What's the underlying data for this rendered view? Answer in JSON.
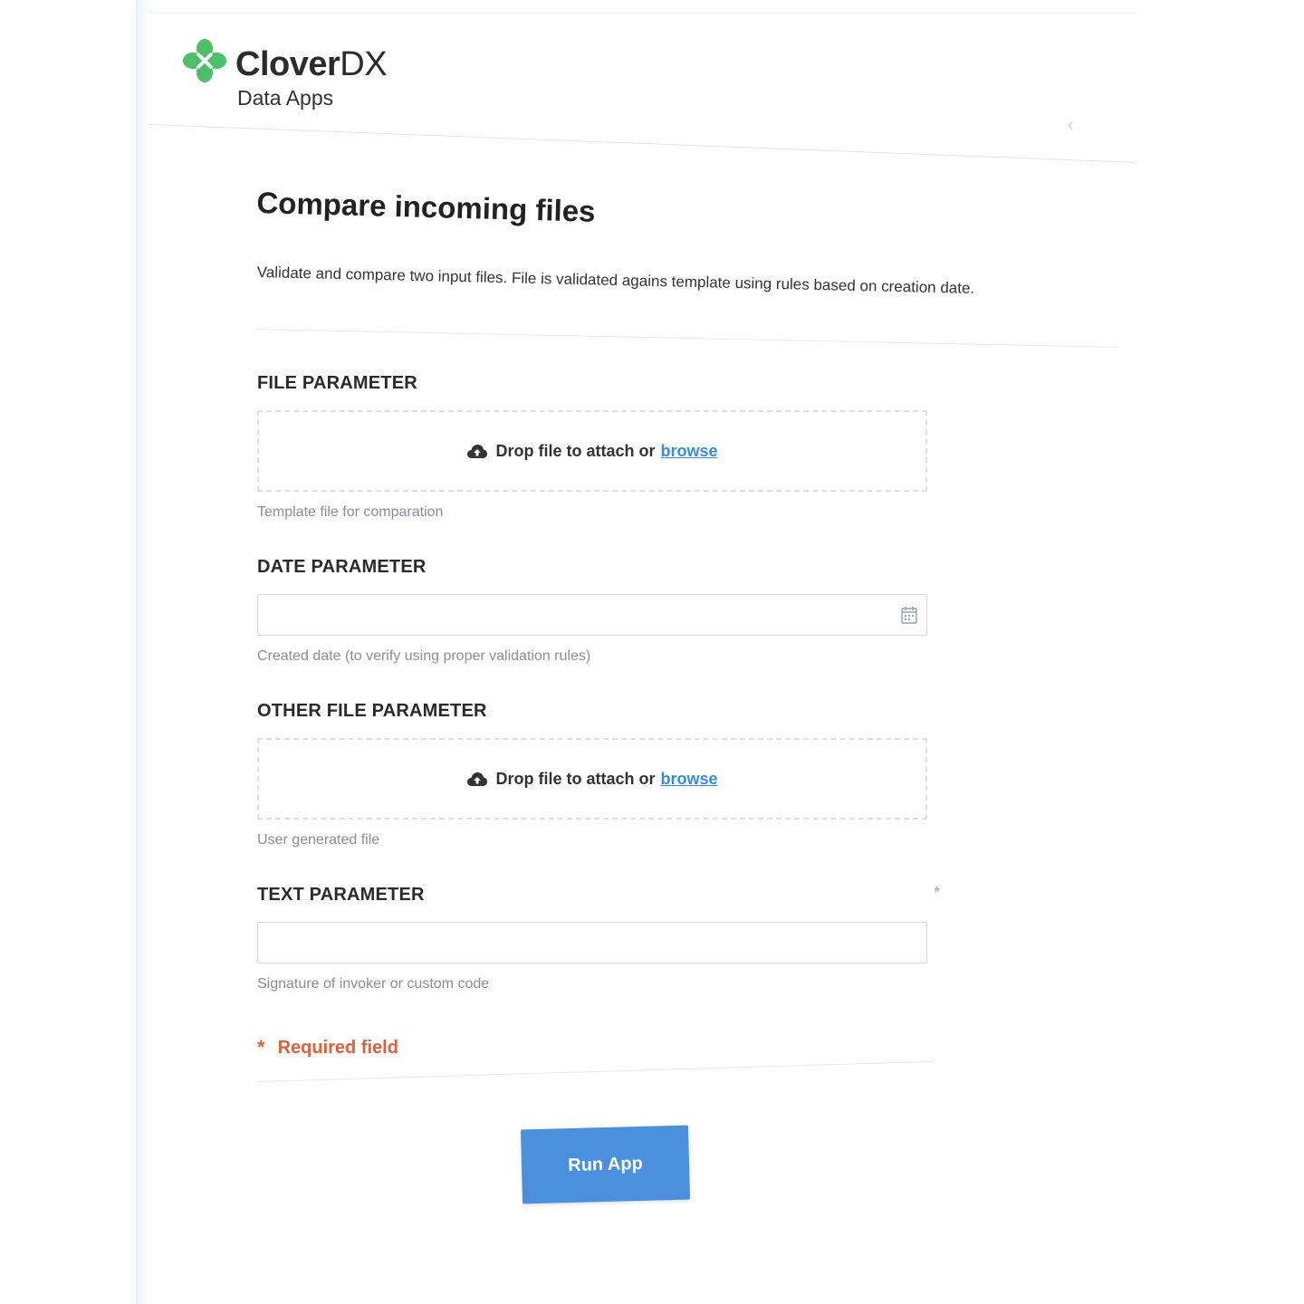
{
  "brand": {
    "name_bold": "Clover",
    "name_light": "DX",
    "subtitle": "Data Apps",
    "logo_color": "#4cbf6b"
  },
  "app": {
    "title": "Compare incoming files",
    "description": "Validate and compare two input files. File is validated agains template using rules based on creation date."
  },
  "fields": {
    "file_parameter": {
      "label": "FILE PARAMETER",
      "drop_text": "Drop file to attach or",
      "browse_label": "browse",
      "help": "Template file for comparation"
    },
    "date_parameter": {
      "label": "DATE PARAMETER",
      "value": "",
      "help": "Created date (to verify using proper validation rules)"
    },
    "other_file_parameter": {
      "label": "OTHER FILE PARAMETER",
      "drop_text": "Drop file to attach or",
      "browse_label": "browse",
      "help": "User generated file"
    },
    "text_parameter": {
      "label": "TEXT PARAMETER",
      "required_marker": "*",
      "value": "",
      "help": "Signature of invoker or custom code"
    }
  },
  "required_note": {
    "star": "*",
    "text": "Required field",
    "color": "#e0603c"
  },
  "run_button": {
    "label": "Run App",
    "color": "#4a90dc"
  },
  "nav": {
    "back_glyph": "‹"
  },
  "icons": {
    "upload": "cloud-upload-icon",
    "calendar": "calendar-icon",
    "logo": "clover-logo-icon"
  }
}
